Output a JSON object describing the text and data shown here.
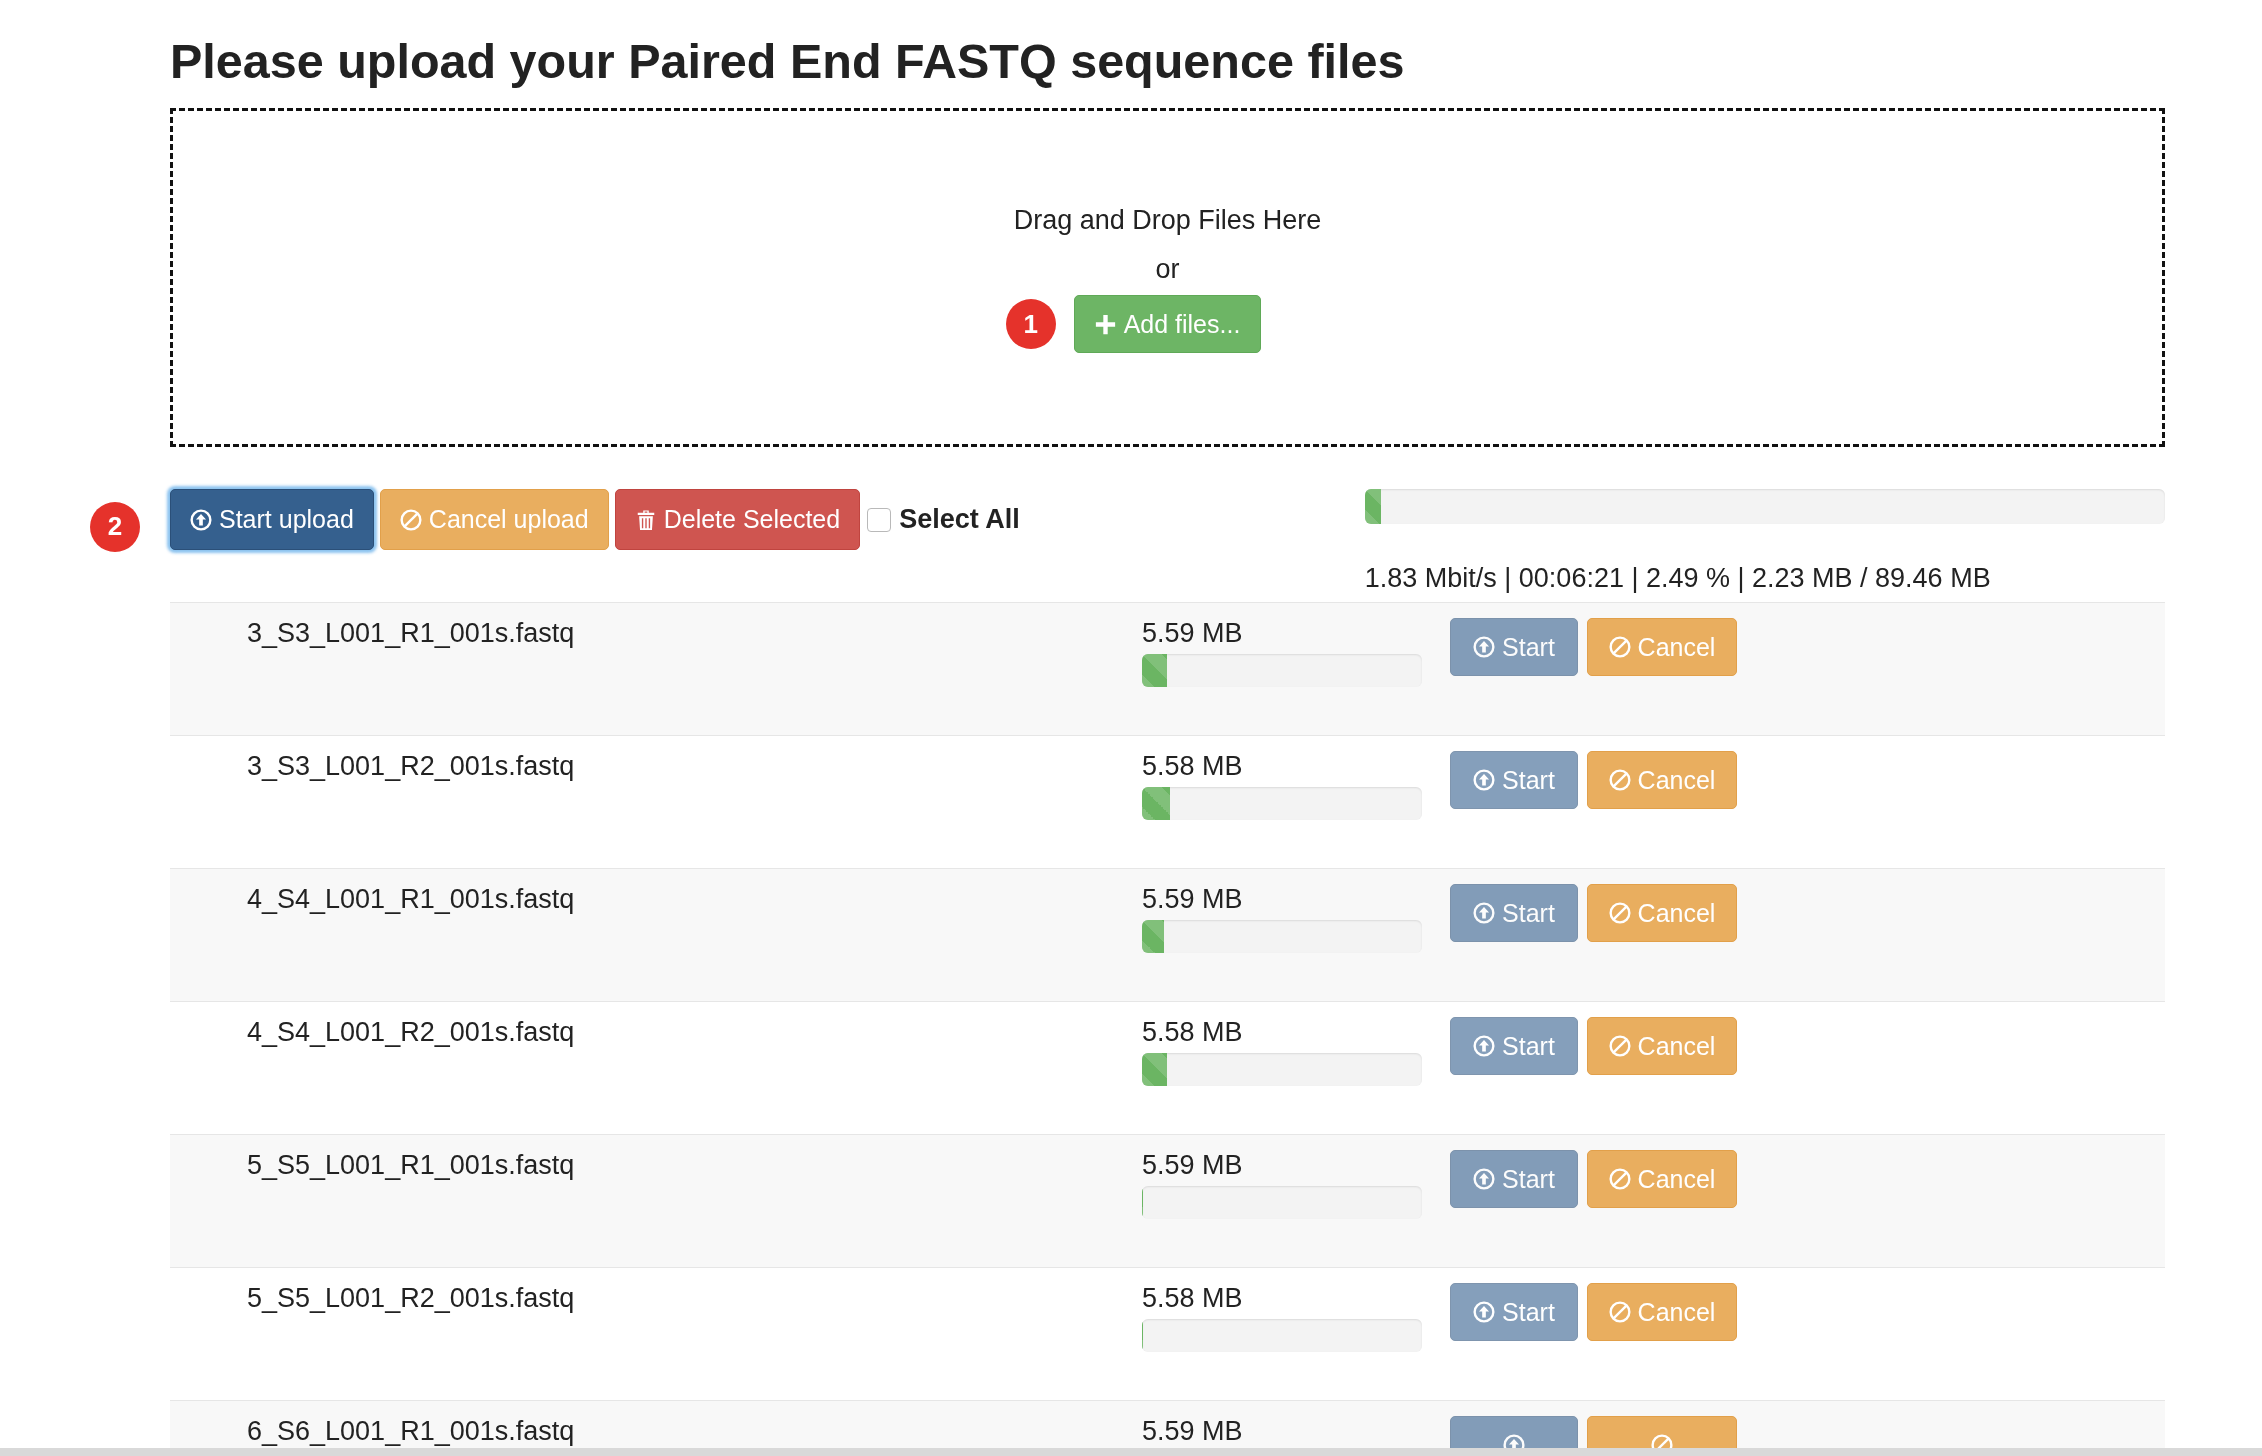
{
  "page": {
    "title": "Please upload your Paired End FASTQ sequence files"
  },
  "dropzone": {
    "prompt": "Drag and Drop Files Here",
    "separator": "or",
    "step": "1",
    "add_button": {
      "label": "Add files..."
    }
  },
  "toolbar": {
    "step": "2",
    "buttons": [
      {
        "kind": "start",
        "label": "Start upload",
        "focused": true
      },
      {
        "kind": "cancel",
        "label": "Cancel upload",
        "focused": false
      },
      {
        "kind": "delete",
        "label": "Delete Selected",
        "focused": false
      }
    ],
    "select_all": {
      "label": "Select All",
      "checked": false
    },
    "progress": {
      "level": 0.02
    },
    "stats": "1.83 Mbit/s | 00:06:21 | 2.49 % | 2.23 MB / 89.46 MB"
  },
  "files": [
    {
      "name": "3_S3_L001_R1_001s.fastq",
      "size": "5.59 MB",
      "level": 0.09,
      "buttons": [
        {
          "kind": "start",
          "label": "Start",
          "disabled": true
        },
        {
          "kind": "cancel",
          "label": "Cancel",
          "disabled": false
        }
      ]
    },
    {
      "name": "3_S3_L001_R2_001s.fastq",
      "size": "5.58 MB",
      "level": 0.1,
      "buttons": [
        {
          "kind": "start",
          "label": "Start",
          "disabled": true
        },
        {
          "kind": "cancel",
          "label": "Cancel",
          "disabled": false
        }
      ]
    },
    {
      "name": "4_S4_L001_R1_001s.fastq",
      "size": "5.59 MB",
      "level": 0.08,
      "buttons": [
        {
          "kind": "start",
          "label": "Start",
          "disabled": true
        },
        {
          "kind": "cancel",
          "label": "Cancel",
          "disabled": false
        }
      ]
    },
    {
      "name": "4_S4_L001_R2_001s.fastq",
      "size": "5.58 MB",
      "level": 0.09,
      "buttons": [
        {
          "kind": "start",
          "label": "Start",
          "disabled": true
        },
        {
          "kind": "cancel",
          "label": "Cancel",
          "disabled": false
        }
      ]
    },
    {
      "name": "5_S5_L001_R1_001s.fastq",
      "size": "5.59 MB",
      "level": 0,
      "buttons": [
        {
          "kind": "start",
          "label": "Start",
          "disabled": true
        },
        {
          "kind": "cancel",
          "label": "Cancel",
          "disabled": false
        }
      ]
    },
    {
      "name": "5_S5_L001_R2_001s.fastq",
      "size": "5.58 MB",
      "level": 0,
      "buttons": [
        {
          "kind": "start",
          "label": "Start",
          "disabled": true
        },
        {
          "kind": "cancel",
          "label": "Cancel",
          "disabled": false
        }
      ]
    },
    {
      "name": "6_S6_L001_R1_001s.fastq",
      "size": "5.59 MB",
      "buttons": [
        {
          "kind": "start",
          "disabled": true
        },
        {
          "kind": "cancel",
          "disabled": false
        }
      ]
    }
  ]
}
